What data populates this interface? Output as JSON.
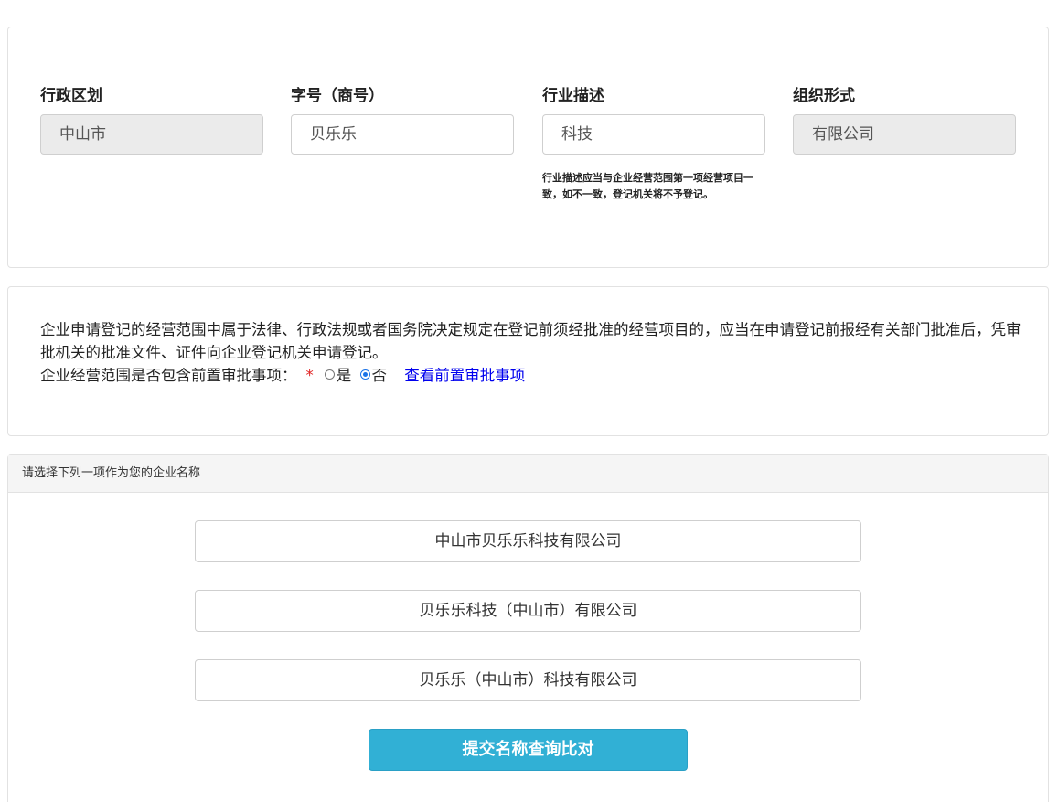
{
  "fields": [
    {
      "label": "行政区划",
      "value": "中山市"
    },
    {
      "label": "字号（商号）",
      "value": "贝乐乐"
    },
    {
      "label": "行业描述",
      "value": "科技",
      "help": "行业描述应当与企业经营范围第一项经营项目一致，如不一致，登记机关将不予登记。"
    },
    {
      "label": "组织形式",
      "value": "有限公司"
    }
  ],
  "notice": {
    "text": "企业申请登记的经营范围中属于法律、行政法规或者国务院决定规定在登记前须经批准的经营项目的，应当在申请登记前报经有关部门批准后，凭审批机关的批准文件、证件向企业登记机关申请登记。",
    "question": "企业经营范围是否包含前置审批事项：",
    "required_mark": "*",
    "option_yes": "是",
    "option_no": "否",
    "selected": "否",
    "link": "查看前置审批事项"
  },
  "names": {
    "header": "请选择下列一项作为您的企业名称",
    "options": [
      "中山市贝乐乐科技有限公司",
      "贝乐乐科技（中山市）有限公司",
      "贝乐乐（中山市）科技有限公司"
    ],
    "submit_label": "提交名称查询比对"
  },
  "colors": {
    "submit": "#31b0d5",
    "link": "#0000ee",
    "required": "#e02020"
  }
}
